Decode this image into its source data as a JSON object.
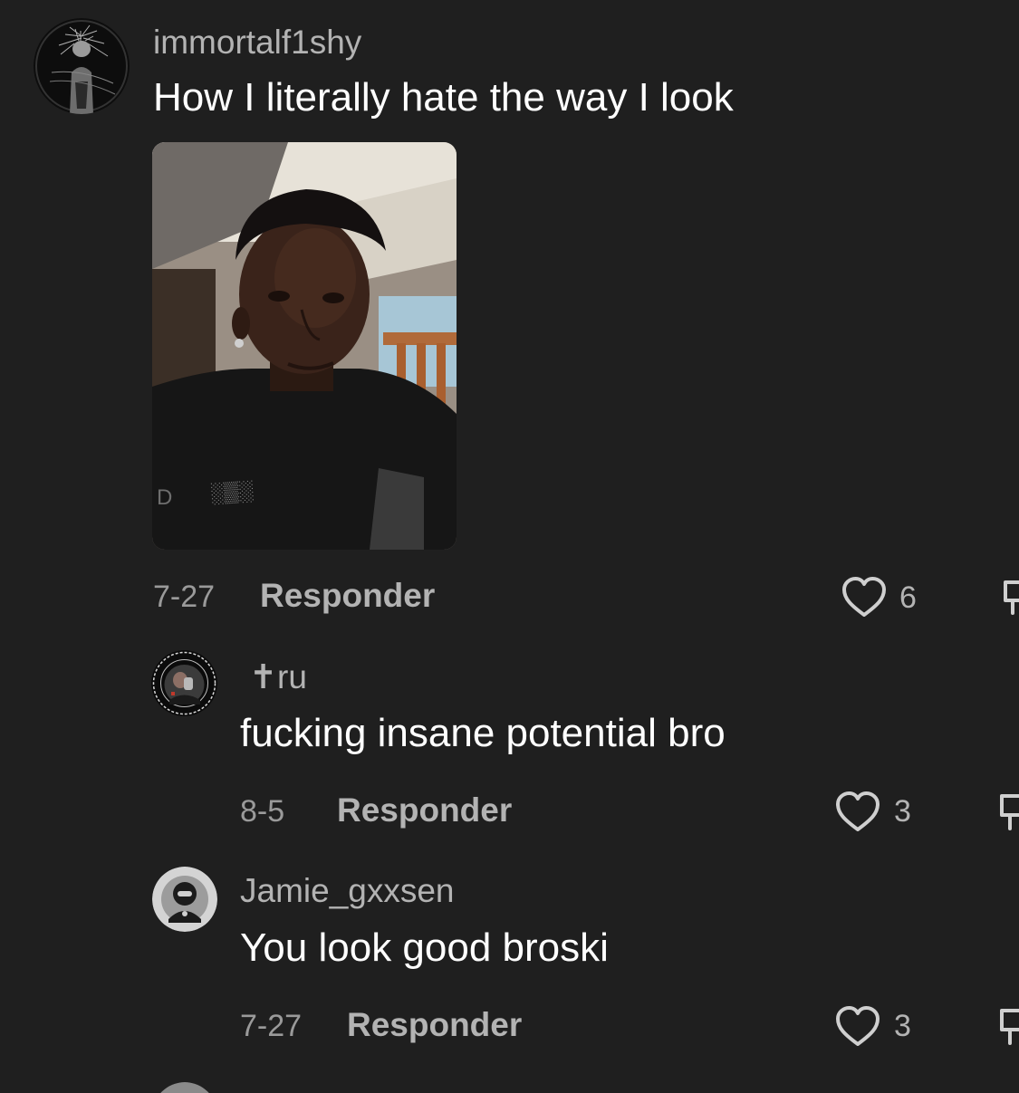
{
  "comments": [
    {
      "username": "immortalf1shy",
      "text": "How I literally hate the way I look",
      "date": "7-27",
      "reply_label": "Responder",
      "likes": "6",
      "attachment": "selfie-photo"
    },
    {
      "username": "✝ru",
      "text": "fucking insane potential bro",
      "date": "8-5",
      "reply_label": "Responder",
      "likes": "3"
    },
    {
      "username": "Jamie_gxxsen",
      "text": "You look good broski",
      "date": "7-27",
      "reply_label": "Responder",
      "likes": "3"
    }
  ],
  "colors": {
    "background": "#1f1f1f",
    "username": "#b3b3b3",
    "text": "#ffffff",
    "meta": "#9a9a9a"
  },
  "icons": [
    "heart-icon",
    "dislike-icon"
  ]
}
